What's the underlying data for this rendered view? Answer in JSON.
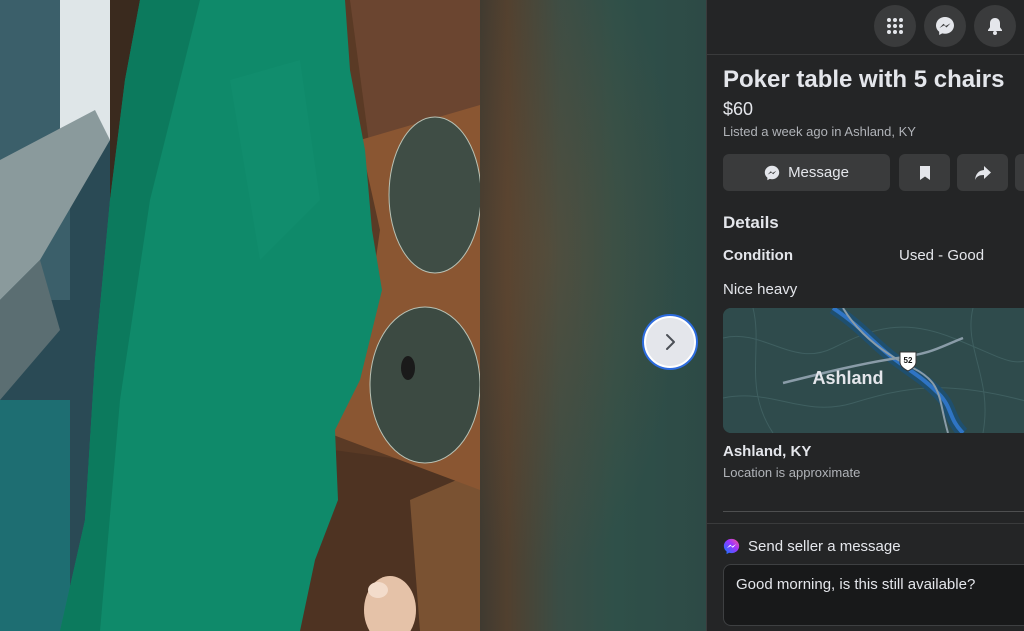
{
  "viewer": {
    "next_label": "Next photo"
  },
  "topbar": {
    "icons": [
      "grid-menu-icon",
      "messenger-icon",
      "bell-icon"
    ]
  },
  "listing": {
    "title": "Poker table with 5 chairs",
    "price": "$60",
    "listed": "Listed a week ago in Ashland, KY",
    "message_label": "Message",
    "details_heading": "Details",
    "condition_label": "Condition",
    "condition_value": "Used - Good",
    "description": "Nice heavy"
  },
  "map": {
    "city_label": "Ashland",
    "route_shield": "52"
  },
  "location": {
    "name": "Ashland, KY",
    "note": "Location is approximate"
  },
  "send": {
    "heading": "Send seller a message",
    "message_value": "Good morning, is this still available?"
  },
  "colors": {
    "panel_bg": "#242526",
    "button_bg": "#3a3b3c",
    "text_primary": "#e4e6eb",
    "text_secondary": "#b0b3b8",
    "felt_green": "#0f8a6a"
  }
}
